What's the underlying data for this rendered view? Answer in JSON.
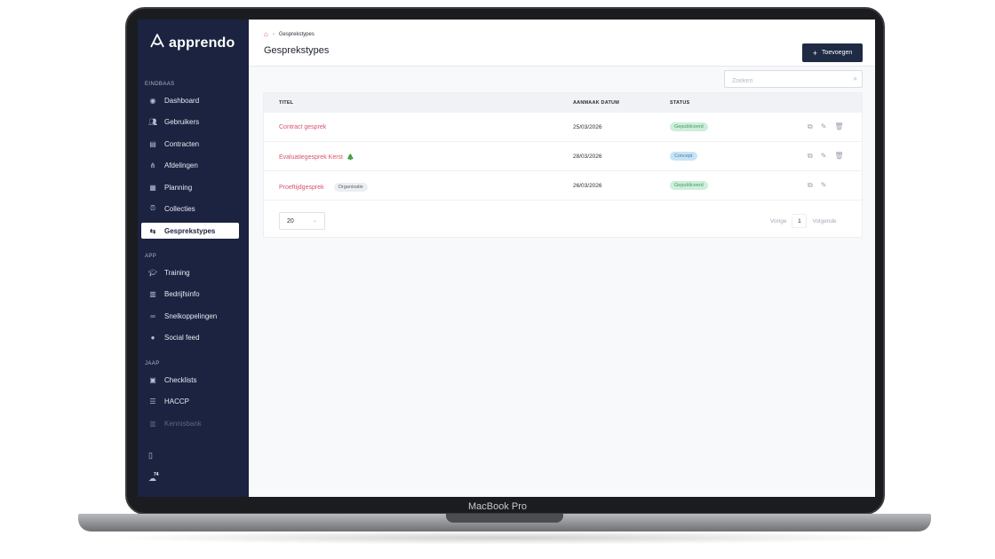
{
  "device": {
    "label": "MacBook Pro"
  },
  "brand": {
    "name": "apprendo",
    "logo_icon": "apprendo-logo-icon"
  },
  "sidebar": {
    "sections": [
      {
        "label": "EINDBAAS"
      },
      {
        "label": "APP"
      },
      {
        "label": "JAAP"
      }
    ],
    "items": [
      {
        "label": "Dashboard",
        "icon": "dashboard-icon"
      },
      {
        "label": "Gebruikers",
        "icon": "users-icon"
      },
      {
        "label": "Contracten",
        "icon": "document-icon"
      },
      {
        "label": "Afdelingen",
        "icon": "hierarchy-icon"
      },
      {
        "label": "Planning",
        "icon": "calendar-icon"
      },
      {
        "label": "Collecties",
        "icon": "alarm-clock-icon"
      },
      {
        "label": "Gesprekstypes",
        "icon": "conversation-icon",
        "active": true
      },
      {
        "label": "Training",
        "icon": "graduation-cap-icon"
      },
      {
        "label": "Bedrijfsinfo",
        "icon": "book-icon"
      },
      {
        "label": "Snelkoppelingen",
        "icon": "link-icon"
      },
      {
        "label": "Social feed",
        "icon": "chat-bubble-icon"
      },
      {
        "label": "Checklists",
        "icon": "checklist-icon"
      },
      {
        "label": "HACCP",
        "icon": "list-icon"
      },
      {
        "label": "Kennisbank",
        "icon": "library-icon",
        "disabled": true
      }
    ],
    "bottom": {
      "notification_count": "74"
    }
  },
  "header": {
    "breadcrumb": {
      "current": "Gesprekstypes"
    },
    "title": "Gesprekstypes",
    "add_button_label": "Toevoegen"
  },
  "search": {
    "placeholder": "Zoeken"
  },
  "table": {
    "columns": [
      "TITEL",
      "AANMAAK DATUM",
      "STATUS"
    ],
    "rows": [
      {
        "title": "Contract gesprek",
        "emoji": "",
        "tag": "",
        "date": "25/03/2026",
        "status": "Gepubliceerd",
        "status_color": "green"
      },
      {
        "title": "Evaluatiegesprek Kerst",
        "emoji": "🎄",
        "tag": "",
        "date": "28/03/2026",
        "status": "Concept",
        "status_color": "blue"
      },
      {
        "title": "Proeftijdgesprek",
        "emoji": "",
        "tag": "Organisatie",
        "date": "26/03/2026",
        "status": "Gepubliceerd",
        "status_color": "green"
      }
    ]
  },
  "pagination": {
    "per_page": "20",
    "prev_label": "Vorige",
    "page": "1",
    "next_label": "Volgende"
  },
  "colors": {
    "sidebar": "#1b2340",
    "accent": "#d9526c",
    "primary_button": "#1f2a44"
  }
}
